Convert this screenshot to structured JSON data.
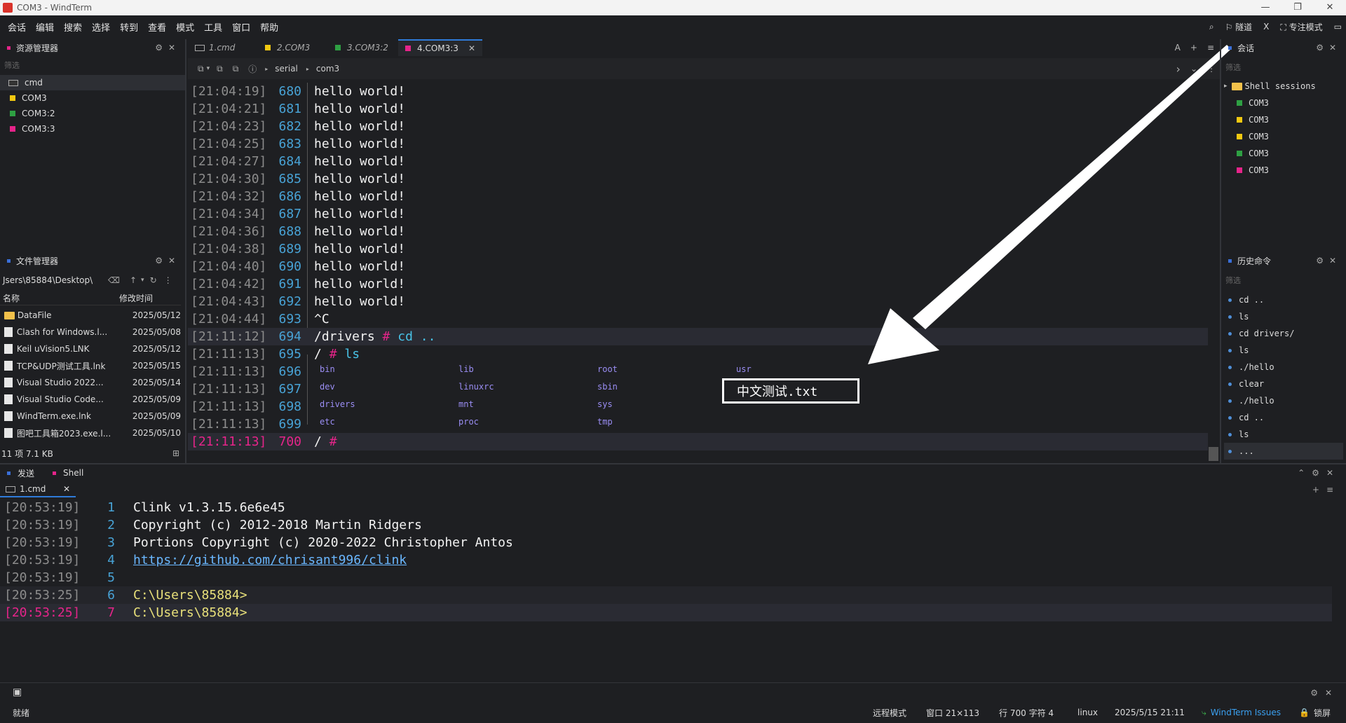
{
  "window": {
    "title": "COM3 - WindTerm",
    "controls": [
      "—",
      "❐",
      "✕"
    ]
  },
  "menu": [
    "会话",
    "编辑",
    "搜索",
    "选择",
    "转到",
    "查看",
    "模式",
    "工具",
    "窗口",
    "帮助"
  ],
  "menu_right": {
    "tunnel": "隧道",
    "x": "X",
    "focus": "专注模式"
  },
  "explorer": {
    "title": "资源管理器",
    "filter": "筛选",
    "items": [
      {
        "label": "cmd",
        "color": "#9aa0a6"
      },
      {
        "label": "COM3",
        "color": "#f2c811"
      },
      {
        "label": "COM3:2",
        "color": "#2ea043"
      },
      {
        "label": "COM3:3",
        "color": "#e6248a"
      }
    ]
  },
  "filemgr": {
    "title": "文件管理器",
    "path": "Jsers\\85884\\Desktop\\",
    "col_name": "名称",
    "col_time": "修改时间",
    "rows": [
      {
        "name": "DataFile",
        "time": "2025/05/12",
        "folder": true
      },
      {
        "name": "Clash for Windows.l...",
        "time": "2025/05/08",
        "folder": false
      },
      {
        "name": "Keil uVision5.LNK",
        "time": "2025/05/12",
        "folder": false
      },
      {
        "name": "TCP&UDP测试工具.lnk",
        "time": "2025/05/15",
        "folder": false
      },
      {
        "name": "Visual Studio 2022...",
        "time": "2025/05/14",
        "folder": false
      },
      {
        "name": "Visual Studio Code...",
        "time": "2025/05/09",
        "folder": false
      },
      {
        "name": "WindTerm.exe.lnk",
        "time": "2025/05/09",
        "folder": false
      },
      {
        "name": "图吧工具箱2023.exe.l...",
        "time": "2025/05/10",
        "folder": false
      }
    ],
    "summary": "11 项 7.1 KB"
  },
  "tabs": [
    {
      "label": "1.cmd",
      "color": "#9aa0a6"
    },
    {
      "label": "2.COM3",
      "color": "#f2c811"
    },
    {
      "label": "3.COM3:2",
      "color": "#2ea043"
    },
    {
      "label": "4.COM3:3",
      "color": "#e6248a",
      "close": "✕"
    }
  ],
  "pathbar": {
    "a": "serial",
    "b": "com3"
  },
  "terminal": [
    {
      "ts": "[21:04:19]",
      "ln": "680",
      "text": "hello world!"
    },
    {
      "ts": "[21:04:21]",
      "ln": "681",
      "text": "hello world!"
    },
    {
      "ts": "[21:04:23]",
      "ln": "682",
      "text": "hello world!"
    },
    {
      "ts": "[21:04:25]",
      "ln": "683",
      "text": "hello world!"
    },
    {
      "ts": "[21:04:27]",
      "ln": "684",
      "text": "hello world!"
    },
    {
      "ts": "[21:04:30]",
      "ln": "685",
      "text": "hello world!"
    },
    {
      "ts": "[21:04:32]",
      "ln": "686",
      "text": "hello world!"
    },
    {
      "ts": "[21:04:34]",
      "ln": "687",
      "text": "hello world!"
    },
    {
      "ts": "[21:04:36]",
      "ln": "688",
      "text": "hello world!"
    },
    {
      "ts": "[21:04:38]",
      "ln": "689",
      "text": "hello world!"
    },
    {
      "ts": "[21:04:40]",
      "ln": "690",
      "text": "hello world!"
    },
    {
      "ts": "[21:04:42]",
      "ln": "691",
      "text": "hello world!"
    },
    {
      "ts": "[21:04:43]",
      "ln": "692",
      "text": "hello world!"
    },
    {
      "ts": "[21:04:44]",
      "ln": "693",
      "text": "^C"
    },
    {
      "ts": "[21:11:12]",
      "ln": "694",
      "text": ""
    },
    {
      "ts": "[21:11:13]",
      "ln": "695",
      "text": ""
    },
    {
      "ts": "[21:11:13]",
      "ln": "696",
      "text": ""
    },
    {
      "ts": "[21:11:13]",
      "ln": "697",
      "text": ""
    },
    {
      "ts": "[21:11:13]",
      "ln": "698",
      "text": ""
    },
    {
      "ts": "[21:11:13]",
      "ln": "699",
      "text": ""
    },
    {
      "ts": "[21:11:13]",
      "ln": "700",
      "text": ""
    }
  ],
  "cmd694": {
    "prefix": "/drivers",
    "hash": "#",
    "cmd": "cd .."
  },
  "cmd695": {
    "prefix": "/",
    "hash": "#",
    "cmd": "ls"
  },
  "prompt700": {
    "prefix": "/",
    "hash": "#"
  },
  "ls": {
    "row1": [
      "bin",
      "lib",
      "root",
      "usr"
    ],
    "row2": [
      "dev",
      "linuxrc",
      "sbin"
    ],
    "row3": [
      "drivers",
      "mnt",
      "sys"
    ],
    "row4": [
      "etc",
      "proc",
      "tmp"
    ],
    "highlight": "中文测试.txt"
  },
  "sessions": {
    "title": "会话",
    "filter": "筛选",
    "group": "Shell sessions",
    "items": [
      {
        "label": "COM3",
        "color": "#2ea043"
      },
      {
        "label": "COM3",
        "color": "#f2c811"
      },
      {
        "label": "COM3",
        "color": "#f2c811"
      },
      {
        "label": "COM3",
        "color": "#2ea043"
      },
      {
        "label": "COM3",
        "color": "#e6248a"
      }
    ]
  },
  "history": {
    "title": "历史命令",
    "filter": "筛选",
    "items": [
      "cd ..",
      "ls",
      "cd drivers/",
      "ls",
      "./hello",
      "clear",
      "./hello",
      "cd ..",
      "ls",
      "..."
    ]
  },
  "bottom": {
    "tab_send": "发送",
    "tab_shell": "Shell",
    "subtab": "1.cmd",
    "subclose": "✕"
  },
  "shell": [
    {
      "ts": "[20:53:19]",
      "ln": "1",
      "text": "Clink v1.3.15.6e6e45"
    },
    {
      "ts": "[20:53:19]",
      "ln": "2",
      "text": "Copyright (c) 2012-2018 Martin Ridgers"
    },
    {
      "ts": "[20:53:19]",
      "ln": "3",
      "text": "Portions Copyright (c) 2020-2022 Christopher Antos"
    },
    {
      "ts": "[20:53:19]",
      "ln": "4",
      "text": "https://github.com/chrisant996/clink"
    },
    {
      "ts": "[20:53:19]",
      "ln": "5",
      "text": ""
    },
    {
      "ts": "[20:53:25]",
      "ln": "6",
      "text": "C:\\Users\\85884>"
    },
    {
      "ts": "[20:53:25]",
      "ln": "7",
      "text": "C:\\Users\\85884>"
    }
  ],
  "status": {
    "ready": "就绪",
    "remote": "远程模式",
    "window": "窗口 21×113",
    "pos": "行 700 字符 4",
    "os": "linux",
    "datetime": "2025/5/15 21:11",
    "issues": "WindTerm Issues",
    "lock": "锁屏"
  }
}
